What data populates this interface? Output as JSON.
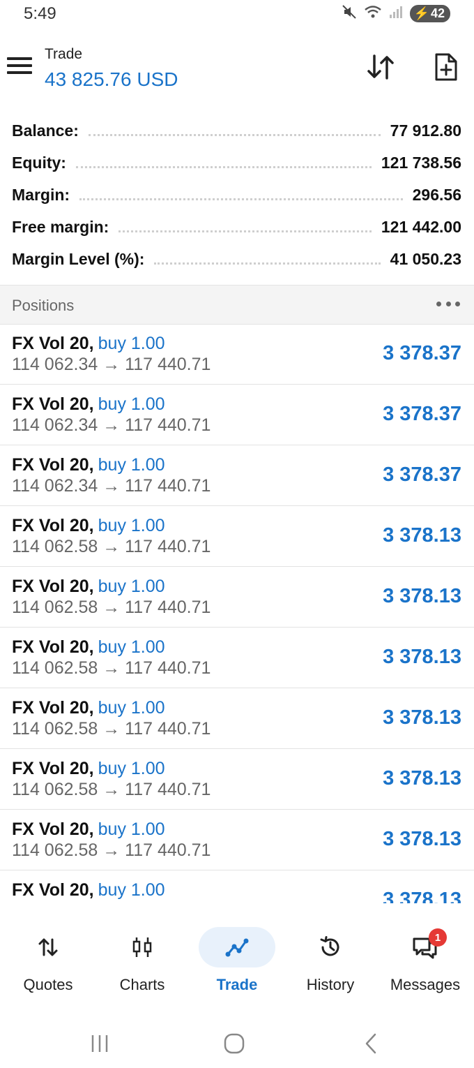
{
  "status_bar": {
    "time": "5:49",
    "battery": "42"
  },
  "header": {
    "title": "Trade",
    "balance": "43 825.76 USD"
  },
  "summary": [
    {
      "label": "Balance:",
      "value": "77 912.80"
    },
    {
      "label": "Equity:",
      "value": "121 738.56"
    },
    {
      "label": "Margin:",
      "value": "296.56"
    },
    {
      "label": "Free margin:",
      "value": "121 442.00"
    },
    {
      "label": "Margin Level (%):",
      "value": "41 050.23"
    }
  ],
  "positions_header": {
    "title": "Positions"
  },
  "positions": [
    {
      "symbol": "FX Vol 20,",
      "side": "buy 1.00",
      "prices": "114 062.34 → 117 440.71",
      "profit": "3 378.37"
    },
    {
      "symbol": "FX Vol 20,",
      "side": "buy 1.00",
      "prices": "114 062.34 → 117 440.71",
      "profit": "3 378.37"
    },
    {
      "symbol": "FX Vol 20,",
      "side": "buy 1.00",
      "prices": "114 062.34 → 117 440.71",
      "profit": "3 378.37"
    },
    {
      "symbol": "FX Vol 20,",
      "side": "buy 1.00",
      "prices": "114 062.58 → 117 440.71",
      "profit": "3 378.13"
    },
    {
      "symbol": "FX Vol 20,",
      "side": "buy 1.00",
      "prices": "114 062.58 → 117 440.71",
      "profit": "3 378.13"
    },
    {
      "symbol": "FX Vol 20,",
      "side": "buy 1.00",
      "prices": "114 062.58 → 117 440.71",
      "profit": "3 378.13"
    },
    {
      "symbol": "FX Vol 20,",
      "side": "buy 1.00",
      "prices": "114 062.58 → 117 440.71",
      "profit": "3 378.13"
    },
    {
      "symbol": "FX Vol 20,",
      "side": "buy 1.00",
      "prices": "114 062.58 → 117 440.71",
      "profit": "3 378.13"
    },
    {
      "symbol": "FX Vol 20,",
      "side": "buy 1.00",
      "prices": "114 062.58 → 117 440.71",
      "profit": "3 378.13"
    },
    {
      "symbol": "FX Vol 20,",
      "side": "buy 1.00",
      "prices": "",
      "profit": "3 378.13"
    }
  ],
  "bottom_nav": [
    {
      "label": "Quotes",
      "icon": "quotes-icon",
      "active": false
    },
    {
      "label": "Charts",
      "icon": "candlestick-icon",
      "active": false
    },
    {
      "label": "Trade",
      "icon": "trade-line-icon",
      "active": true
    },
    {
      "label": "History",
      "icon": "history-icon",
      "active": false
    },
    {
      "label": "Messages",
      "icon": "messages-icon",
      "active": false,
      "badge": "1"
    }
  ],
  "colors": {
    "accent": "#1a73c9",
    "badge": "#e53935",
    "text": "#111111",
    "muted": "#666666"
  }
}
